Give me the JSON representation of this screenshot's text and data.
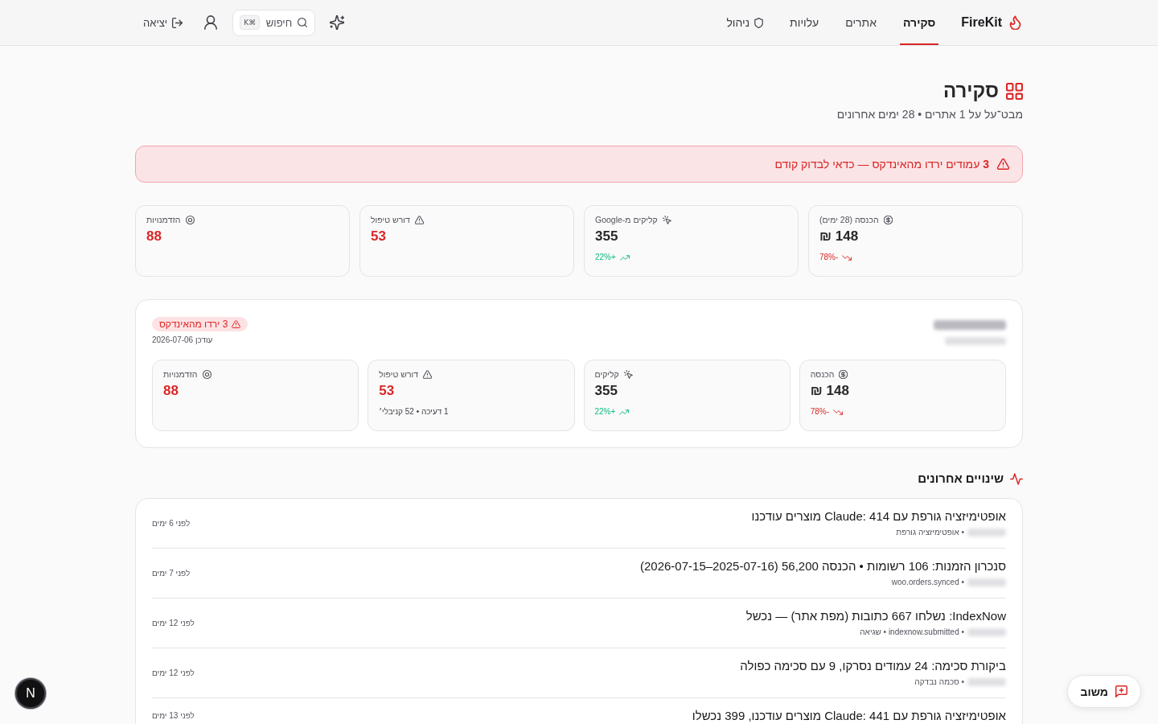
{
  "nav": {
    "brand": "FireKit",
    "tabs": [
      {
        "label": "סקירה",
        "selected": true,
        "kind": "text"
      },
      {
        "label": "אתרים",
        "selected": false,
        "kind": "text"
      },
      {
        "label": "עלויות",
        "selected": false,
        "kind": "text"
      },
      {
        "label": "ניהול",
        "selected": false,
        "kind": "icon"
      }
    ],
    "search": {
      "placeholder": "חיפוש",
      "shortcut": "⌘K"
    },
    "logout": "יציאה"
  },
  "header": {
    "title": "סקירה",
    "subtitle": "מבט־על על 1 אתרים • 28 ימים אחרונים"
  },
  "alert": {
    "text": "**3** עמודים ירדו מהאינדקס — כדאי לבדוק קודם"
  },
  "stats": [
    {
      "kind": "revenue",
      "label": "הכנסה (28 ימים)",
      "value": "148 ₪",
      "flagged": false,
      "trend": {
        "text": "-78%",
        "rising": false
      }
    },
    {
      "kind": "clicks",
      "label": "קליקים מ-Google",
      "value": "355",
      "flagged": false,
      "trend": {
        "text": "+22%",
        "rising": true
      }
    },
    {
      "kind": "issues",
      "label": "דורש טיפול",
      "value": "53",
      "flagged": true
    },
    {
      "kind": "opportunities",
      "label": "הזדמנויות",
      "value": "88",
      "flagged": true
    }
  ],
  "site": {
    "badge": "3 ירדו מהאינדקס",
    "updated": "עודכן 2026-07-06",
    "stats": [
      {
        "kind": "revenue",
        "label": "הכנסה",
        "value": "148 ₪",
        "flagged": false,
        "trend": {
          "text": "-78%",
          "rising": false
        }
      },
      {
        "kind": "clicks",
        "label": "קליקים",
        "value": "355",
        "flagged": false,
        "trend": {
          "text": "+22%",
          "rising": true
        }
      },
      {
        "kind": "issues",
        "label": "דורש טיפול",
        "value": "53",
        "flagged": true,
        "note": "1 דעיכה • 52 קניבלי׳"
      },
      {
        "kind": "opportunities",
        "label": "הזדמנויות",
        "value": "88",
        "flagged": true
      }
    ]
  },
  "recent": {
    "title": "שינויים אחרונים",
    "items": [
      {
        "title": "אופטימיזציה גורפת עם Claude: 414 מוצרים עודכנו",
        "meta": "• אופטימיזציה גורפת",
        "time": "לפני 6 ימים"
      },
      {
        "title": "סנכרון הזמנות: 106 רשומות • הכנסה 56,200 (2025-07-16–2026-07-15)",
        "meta": "• woo.orders.synced",
        "time": "לפני 7 ימים"
      },
      {
        "title": "IndexNow: נשלחו 667 כתובות (מפת אתר) — נכשל",
        "meta": "• indexnow.submitted • שגיאה",
        "time": "לפני 12 ימים"
      },
      {
        "title": "ביקורת סכימה: 24 עמודים נסרקו, 9 עם סכימה כפולה",
        "meta": "• סכמה נבדקה",
        "time": "לפני 12 ימים"
      },
      {
        "title": "אופטימיזציה גורפת עם Claude: 441 מוצרים עודכנו, 399 נכשלו",
        "time": "לפני 13 ימים"
      }
    ]
  },
  "feedback": {
    "label": "משוב"
  },
  "dev_indicator": {
    "label": "N"
  }
}
